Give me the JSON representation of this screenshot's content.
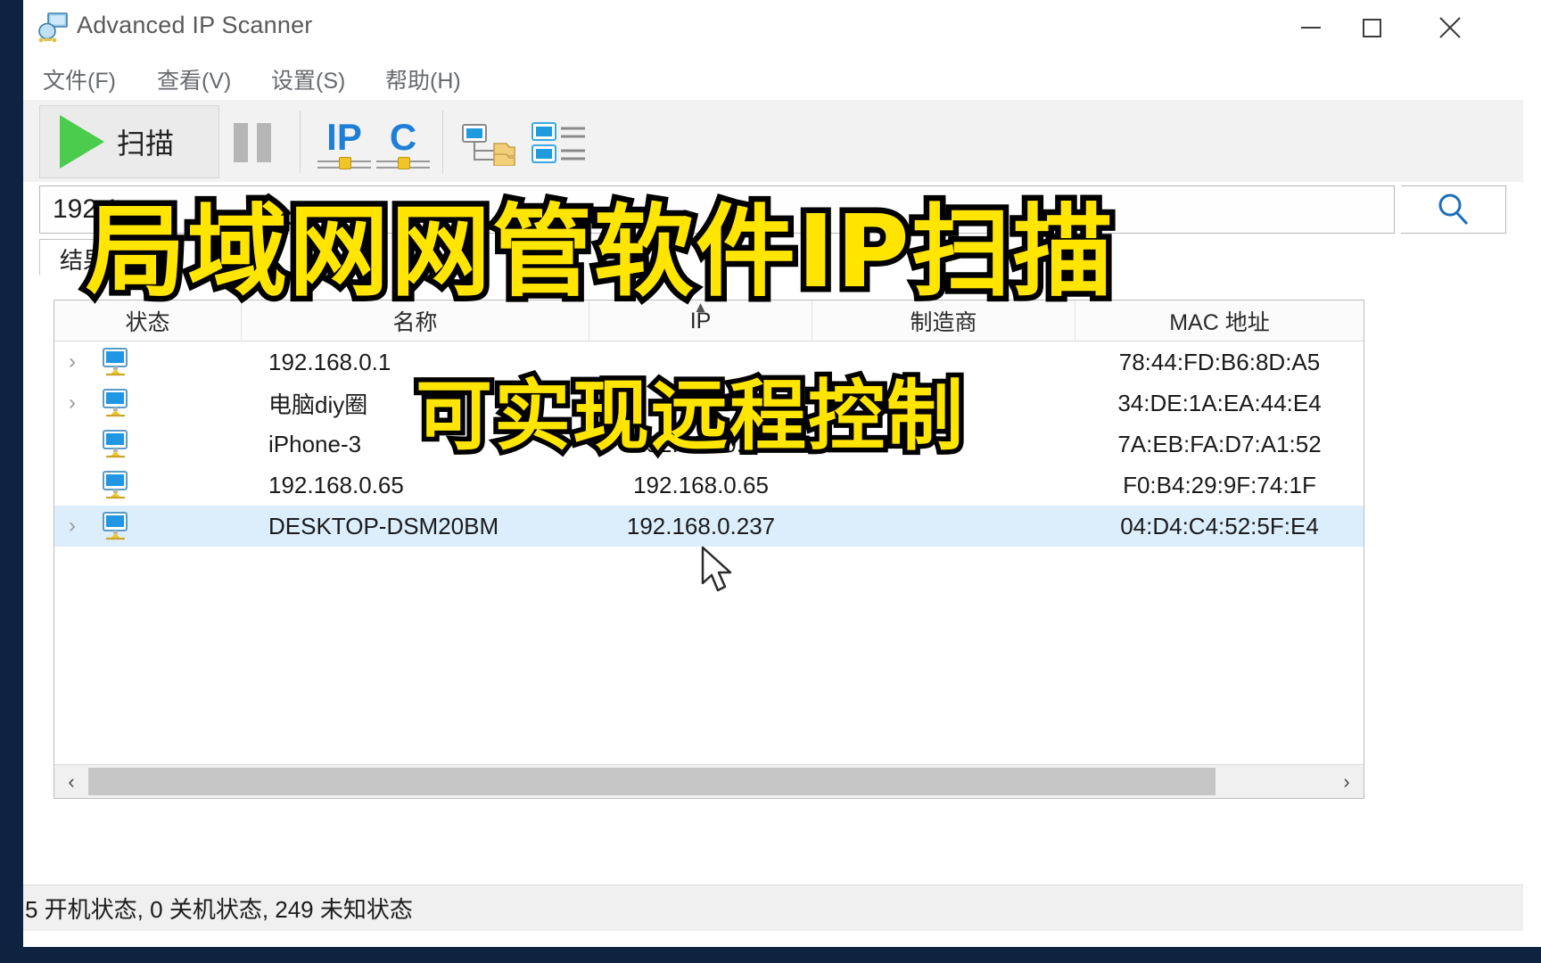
{
  "window": {
    "title": "Advanced IP Scanner",
    "app_icon": "network-scanner-icon",
    "minimize_label": "minimize",
    "maximize_label": "maximize",
    "close_label": "close"
  },
  "menu": {
    "items": [
      {
        "label": "文件(F)"
      },
      {
        "label": "查看(V)"
      },
      {
        "label": "设置(S)"
      },
      {
        "label": "帮助(H)"
      }
    ]
  },
  "toolbar": {
    "scan_label": "扫描",
    "pause_label": "暂停",
    "ip_tool_label": "IP",
    "c_tool_label": "C",
    "tree_view_label": "树形视图",
    "list_view_label": "列表视图"
  },
  "search": {
    "ip_range_value": "192.1",
    "placeholder": "",
    "search_icon": "search-icon"
  },
  "tabs": [
    {
      "label": "结果",
      "active": true
    }
  ],
  "table": {
    "columns": [
      {
        "label": "状态",
        "sorted": false
      },
      {
        "label": "名称",
        "sorted": false
      },
      {
        "label": "IP",
        "sorted": true,
        "sort_dir": "asc"
      },
      {
        "label": "制造商",
        "sorted": false
      },
      {
        "label": "MAC 地址",
        "sorted": false
      }
    ],
    "rows": [
      {
        "expandable": true,
        "status_icon": "computer-online-icon",
        "name": "192.168.0.1",
        "ip": "",
        "vendor": "",
        "mac": "78:44:FD:B6:8D:A5",
        "selected": false
      },
      {
        "expandable": true,
        "status_icon": "computer-online-icon",
        "name": "电脑diy圈",
        "ip": "",
        "vendor": "",
        "mac": "34:DE:1A:EA:44:E4",
        "selected": false
      },
      {
        "expandable": false,
        "status_icon": "computer-online-icon",
        "name": "iPhone-3",
        "ip": "192.168.0.32",
        "vendor": "",
        "mac": "7A:EB:FA:D7:A1:52",
        "selected": false
      },
      {
        "expandable": false,
        "status_icon": "computer-online-icon",
        "name": "192.168.0.65",
        "ip": "192.168.0.65",
        "vendor": "",
        "mac": "F0:B4:29:9F:74:1F",
        "selected": false
      },
      {
        "expandable": true,
        "status_icon": "computer-online-icon",
        "name": "DESKTOP-DSM20BM",
        "ip": "192.168.0.237",
        "vendor": "",
        "mac": "04:D4:C4:52:5F:E4",
        "selected": true
      }
    ]
  },
  "scrollbar": {
    "left_arrow": "‹",
    "right_arrow": "›"
  },
  "statusbar": {
    "text": "5 开机状态,  0 关机状态,  249 未知状态"
  },
  "overlay": {
    "headline": "局域网网管软件IP扫描",
    "subline": "可实现远程控制",
    "text_color": "#ffe500",
    "stroke_color": "#000000"
  }
}
